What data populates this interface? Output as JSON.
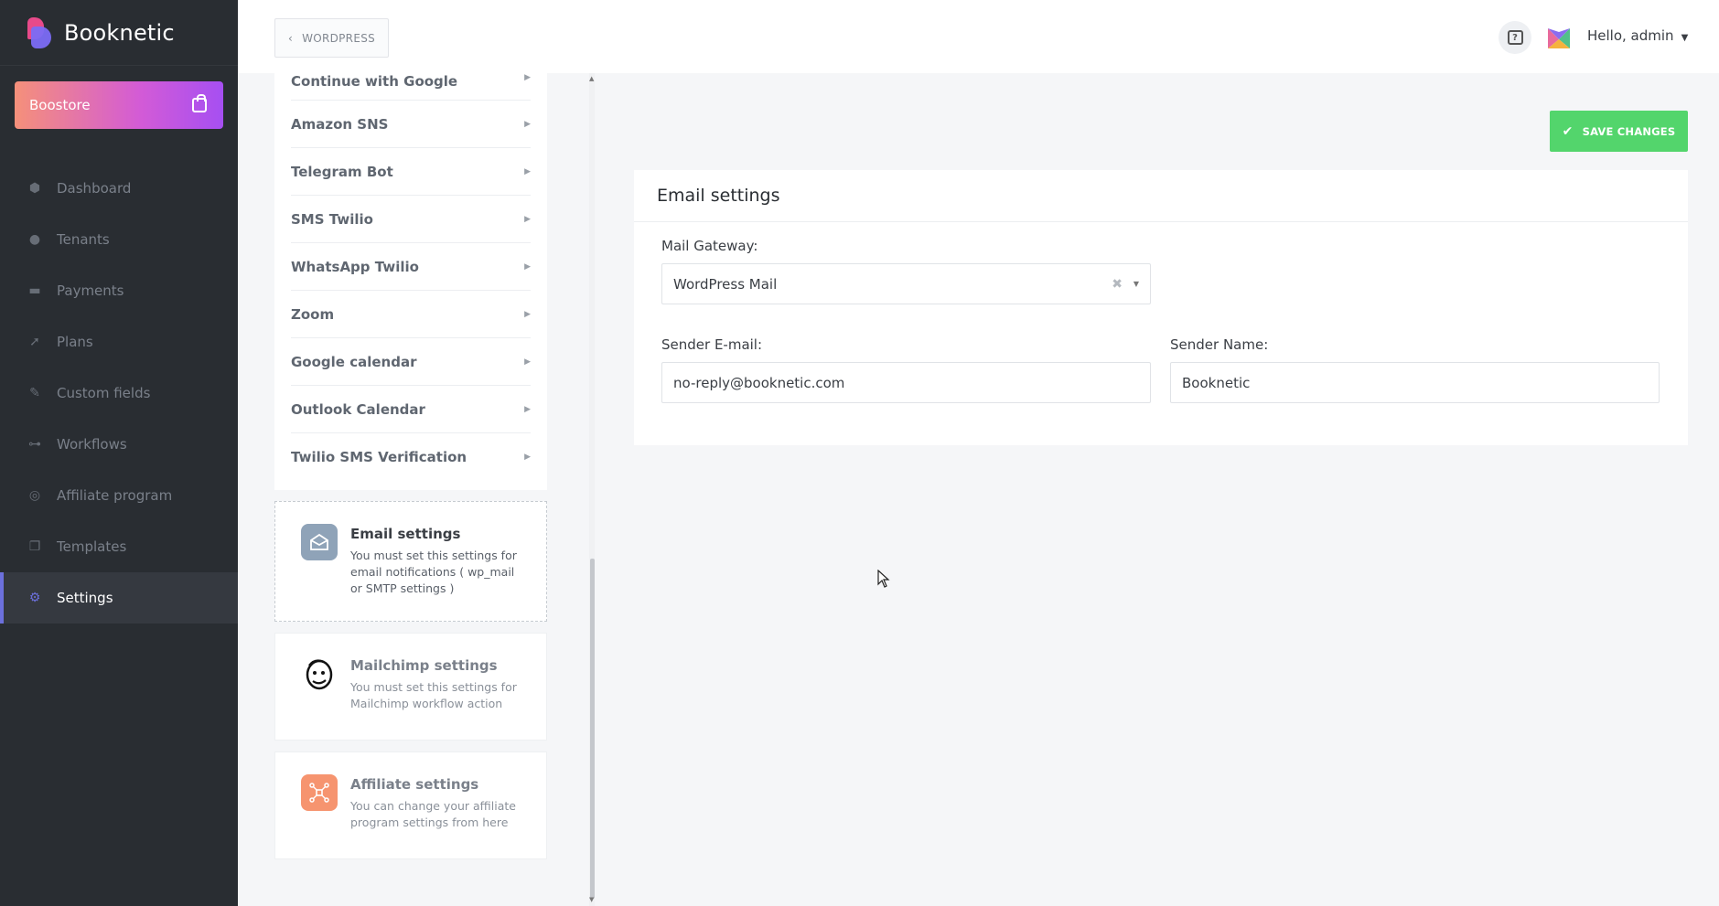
{
  "brand": {
    "name": "Booknetic"
  },
  "boostore": {
    "label": "Boostore"
  },
  "menu": [
    {
      "label": "Dashboard",
      "icon": "cube-icon",
      "glyph": "⬢"
    },
    {
      "label": "Tenants",
      "icon": "user-icon",
      "glyph": "●"
    },
    {
      "label": "Payments",
      "icon": "credit-card-icon",
      "glyph": "▬"
    },
    {
      "label": "Plans",
      "icon": "rocket-icon",
      "glyph": "➚"
    },
    {
      "label": "Custom fields",
      "icon": "magic-wand-icon",
      "glyph": "✎"
    },
    {
      "label": "Workflows",
      "icon": "workflow-icon",
      "glyph": "⊶"
    },
    {
      "label": "Affiliate program",
      "icon": "target-icon",
      "glyph": "◎"
    },
    {
      "label": "Templates",
      "icon": "copy-icon",
      "glyph": "❐"
    },
    {
      "label": "Settings",
      "icon": "gear-icon",
      "glyph": "⚙"
    }
  ],
  "header": {
    "back_label": "WORDPRESS",
    "user_greeting": "Hello, admin"
  },
  "settings_list": [
    "Continue with Google",
    "Amazon SNS",
    "Telegram Bot",
    "SMS Twilio",
    "WhatsApp Twilio",
    "Zoom",
    "Google calendar",
    "Outlook Calendar",
    "Twilio SMS Verification"
  ],
  "cards": {
    "email": {
      "title": "Email settings",
      "desc": "You must set this settings for email notifications ( wp_mail or SMTP settings )",
      "icon": "envelope-icon",
      "color": "#8fa3b8"
    },
    "mailchimp": {
      "title": "Mailchimp settings",
      "desc": "You must set this settings for Mailchimp workflow action",
      "icon": "mailchimp-icon"
    },
    "affiliate": {
      "title": "Affiliate settings",
      "desc": "You can change your affiliate program settings from here",
      "icon": "network-icon",
      "color": "#f6946f"
    }
  },
  "save_button": {
    "label": "SAVE CHANGES",
    "color": "#53d56c"
  },
  "email_settings": {
    "title": "Email settings",
    "gateway_label": "Mail Gateway:",
    "gateway_value": "WordPress Mail",
    "sender_email_label": "Sender E-mail:",
    "sender_email_value": "no-reply@booknetic.com",
    "sender_name_label": "Sender Name:",
    "sender_name_value": "Booknetic"
  },
  "accent_color": "#6c70dc"
}
